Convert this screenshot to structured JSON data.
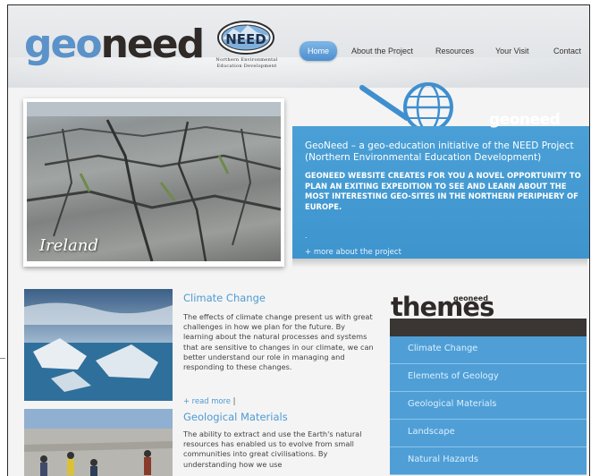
{
  "brand": {
    "logo_geo": "geo",
    "logo_need": "need",
    "badge_text": "NEED",
    "badge_caption_line1": "Northern Environmental",
    "badge_caption_line2": "Education Development"
  },
  "nav": {
    "items": [
      {
        "label": "Home",
        "active": true
      },
      {
        "label": "About the Project",
        "active": false
      },
      {
        "label": "Resources",
        "active": false
      },
      {
        "label": "Your Visit",
        "active": false
      },
      {
        "label": "Contact",
        "active": false
      }
    ]
  },
  "hero": {
    "photo_caption": "Ireland",
    "globe_label": "geoneed",
    "title": "GeoNeed – a geo-education initiative of the NEED Project (Northern Environmental Education Development)",
    "body": "GEONEED WEBSITE CREATES FOR YOU A NOVEL OPPORTUNITY TO PLAN AN EXITING EXPEDITION TO SEE AND LEARN ABOUT THE MOST INTERESTING GEO-SITES IN THE NORTHERN PERIPHERY OF EUROPE.",
    "dot": ".",
    "more_link": "+ more about the project"
  },
  "articles": [
    {
      "title": "Climate Change",
      "body": "The effects of climate change present us with great challenges in how we plan for the future. By learning about the natural processes and systems that are sensitive to changes in our climate, we can better understand our role in managing and responding to these changes.",
      "read_more": "+ read more",
      "separator": "|"
    },
    {
      "title": "Geological Materials",
      "body": "The ability to extract and use the Earth's natural resources has enabled us to evolve from small communities into great civilisations. By understanding how we use"
    }
  ],
  "themes": {
    "heading_small": "geoneed",
    "heading": "themes",
    "items": [
      "Climate Change",
      "Elements of Geology",
      "Geological Materials",
      "Landscape",
      "Natural Hazards"
    ]
  },
  "colors": {
    "accent_blue": "#4d9ad4",
    "panel_blue": "#4aa0d6",
    "dark_brown": "#2f2a28"
  }
}
